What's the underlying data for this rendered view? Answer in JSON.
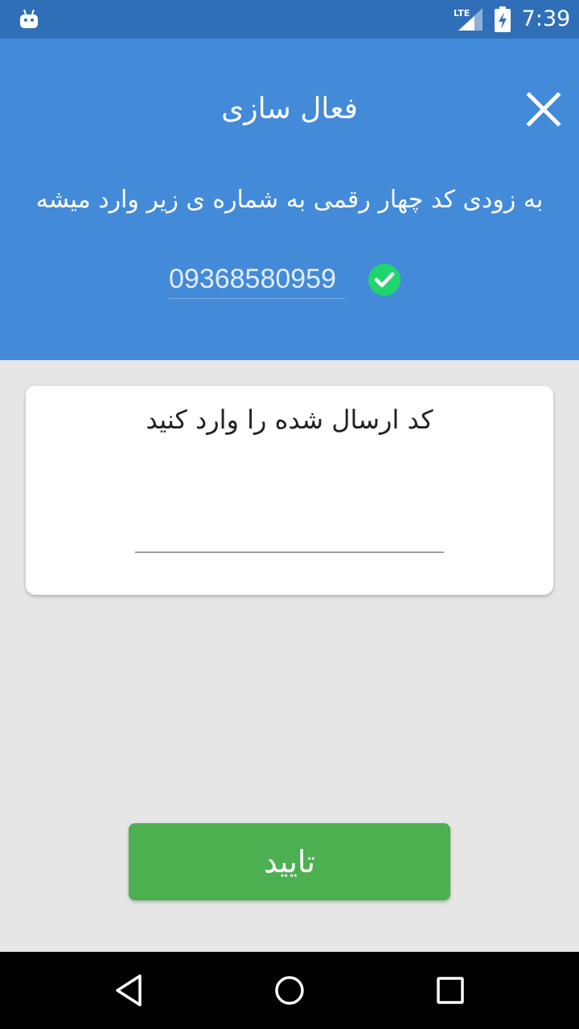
{
  "status_bar": {
    "network": "LTE",
    "time": "7:39",
    "icons": [
      "android-icon",
      "lte-signal-icon",
      "battery-charging-icon"
    ]
  },
  "header": {
    "title": "فعال سازی",
    "subtitle": "به زودی کد چهار رقمی به شماره ی زیر وارد میشه",
    "phone_number": "09368580959",
    "close_icon": "close-icon",
    "verified_icon": "check-circle-icon",
    "background_color": "#438ad9"
  },
  "card": {
    "title": "کد ارسال شده را وارد کنید",
    "code_value": "",
    "code_placeholder": ""
  },
  "confirm_button": {
    "label": "تایید",
    "color": "#4caf50"
  },
  "nav_bar": {
    "buttons": [
      "back-icon",
      "home-icon",
      "recents-icon"
    ]
  },
  "colors": {
    "status_bar": "#2f6fb8",
    "check": "#1fd66e",
    "page_background": "#e6e6e6"
  }
}
